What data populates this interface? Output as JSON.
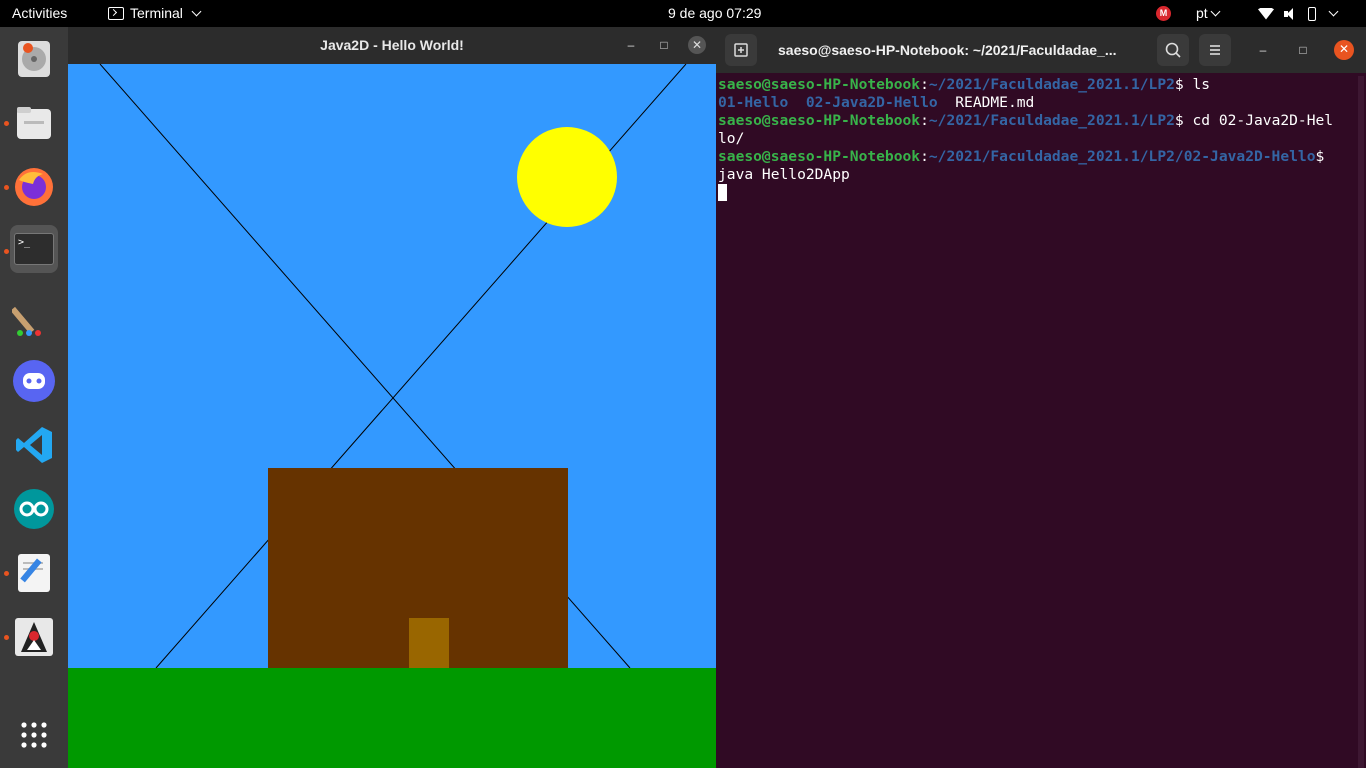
{
  "topbar": {
    "activities": "Activities",
    "app_name": "Terminal",
    "clock": "9 de ago  07:29",
    "mega_badge": "M",
    "language": "pt"
  },
  "dock": {
    "items": [
      {
        "name": "disk-installer-icon"
      },
      {
        "name": "files-icon"
      },
      {
        "name": "firefox-icon"
      },
      {
        "name": "terminal-icon",
        "label": ">_"
      },
      {
        "name": "paint-brush-icon"
      },
      {
        "name": "discord-icon"
      },
      {
        "name": "vscode-icon"
      },
      {
        "name": "arduino-icon"
      },
      {
        "name": "text-editor-icon"
      },
      {
        "name": "java-duke-icon"
      }
    ]
  },
  "java_window": {
    "title": "Java2D - Hello World!",
    "colors": {
      "sky": "#3399ff",
      "sun": "#ffff00",
      "house": "#663300",
      "door": "#996600",
      "grass": "#009900",
      "lines": "#000000"
    }
  },
  "terminal": {
    "title": "saeso@saeso-HP-Notebook: ~/2021/Faculdadae_...",
    "lines": [
      {
        "user": "saeso@saeso-HP-Notebook",
        "path": "~/2021/Faculdadae_2021.1/LP2",
        "cmd": " ls"
      },
      {
        "ls": [
          "01-Hello",
          "02-Java2D-Hello"
        ],
        "file": "README.md"
      },
      {
        "user": "saeso@saeso-HP-Notebook",
        "path": "~/2021/Faculdadae_2021.1/LP2",
        "cmd": " cd 02-Java2D-Hel"
      },
      {
        "text": "lo/"
      },
      {
        "user": "saeso@saeso-HP-Notebook",
        "path": "~/2021/Faculdadae_2021.1/LP2/02-Java2D-Hello",
        "cmd": ""
      },
      {
        "text": "java Hello2DApp"
      }
    ]
  }
}
